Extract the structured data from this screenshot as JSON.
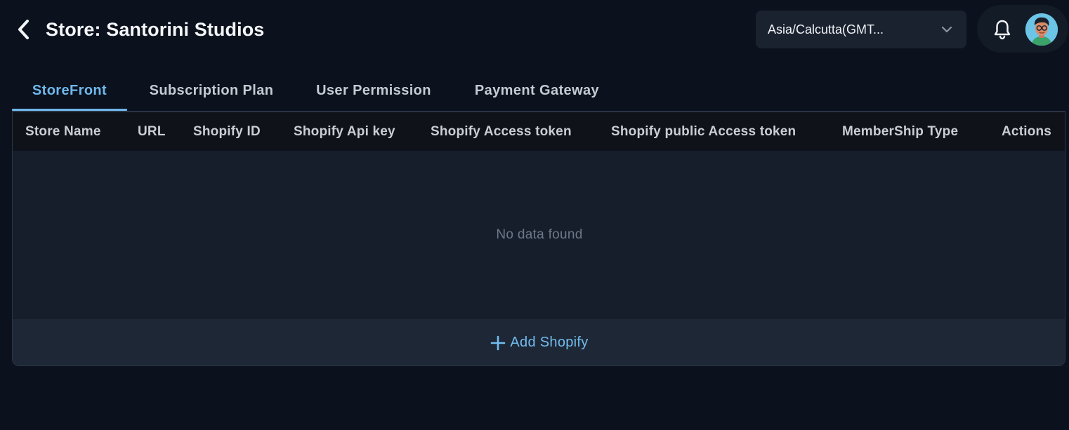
{
  "header": {
    "title": "Store: Santorini Studios",
    "timezone": {
      "value": "Asia/Calcutta(GMT..."
    }
  },
  "tabs": [
    {
      "label": "StoreFront",
      "active": true
    },
    {
      "label": "Subscription Plan",
      "active": false
    },
    {
      "label": "User Permission",
      "active": false
    },
    {
      "label": "Payment Gateway",
      "active": false
    }
  ],
  "table": {
    "columns": [
      "Store Name",
      "URL",
      "Shopify ID",
      "Shopify Api key",
      "Shopify Access token",
      "Shopify public Access token",
      "MemberShip Type",
      "Actions"
    ],
    "rows": [],
    "empty_text": "No data found",
    "add_label": "Add Shopify"
  },
  "icons": {
    "back": "chevron-left-icon",
    "timezone_dropdown": "chevron-down-icon",
    "notifications": "bell-icon",
    "add": "plus-icon"
  },
  "colors": {
    "background": "#0b111d",
    "accent": "#6fb8ec",
    "surface": "#1a2230"
  }
}
